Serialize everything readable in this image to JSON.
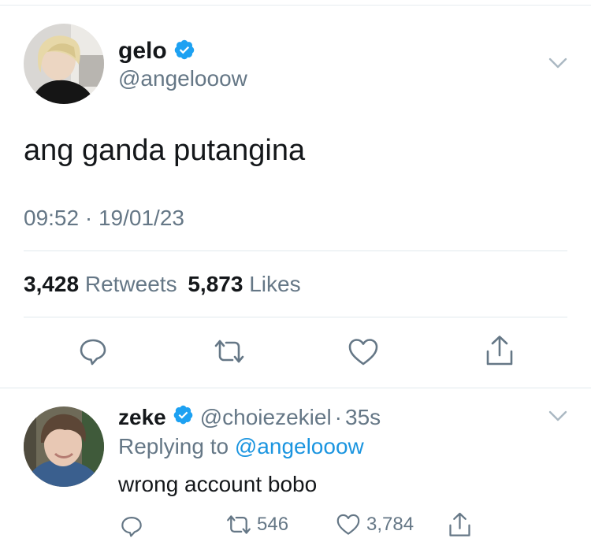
{
  "tweet": {
    "display_name": "gelo",
    "handle": "@angelooow",
    "text": "ang ganda putangina",
    "time": "09:52",
    "separator": "·",
    "date": "19/01/23",
    "retweet_count": "3,428",
    "retweet_label": "Retweets",
    "like_count": "5,873",
    "like_label": "Likes",
    "verified": true
  },
  "reply": {
    "display_name": "zeke",
    "handle": "@choiezekiel",
    "separator": "·",
    "age": "35s",
    "replying_prefix": "Replying to",
    "replying_handle": "@angelooow",
    "text": "wrong account bobo",
    "retweet_count": "546",
    "like_count": "3,784",
    "verified": true
  },
  "icons": {
    "reply": "reply-icon",
    "retweet": "retweet-icon",
    "like": "heart-icon",
    "share": "share-icon",
    "menu": "chevron-down-icon",
    "verified": "verified-badge-icon"
  },
  "colors": {
    "text": "#14171a",
    "muted": "#657786",
    "link": "#1b95e0",
    "verified": "#1da1f2",
    "divider": "#e1e8ed"
  }
}
